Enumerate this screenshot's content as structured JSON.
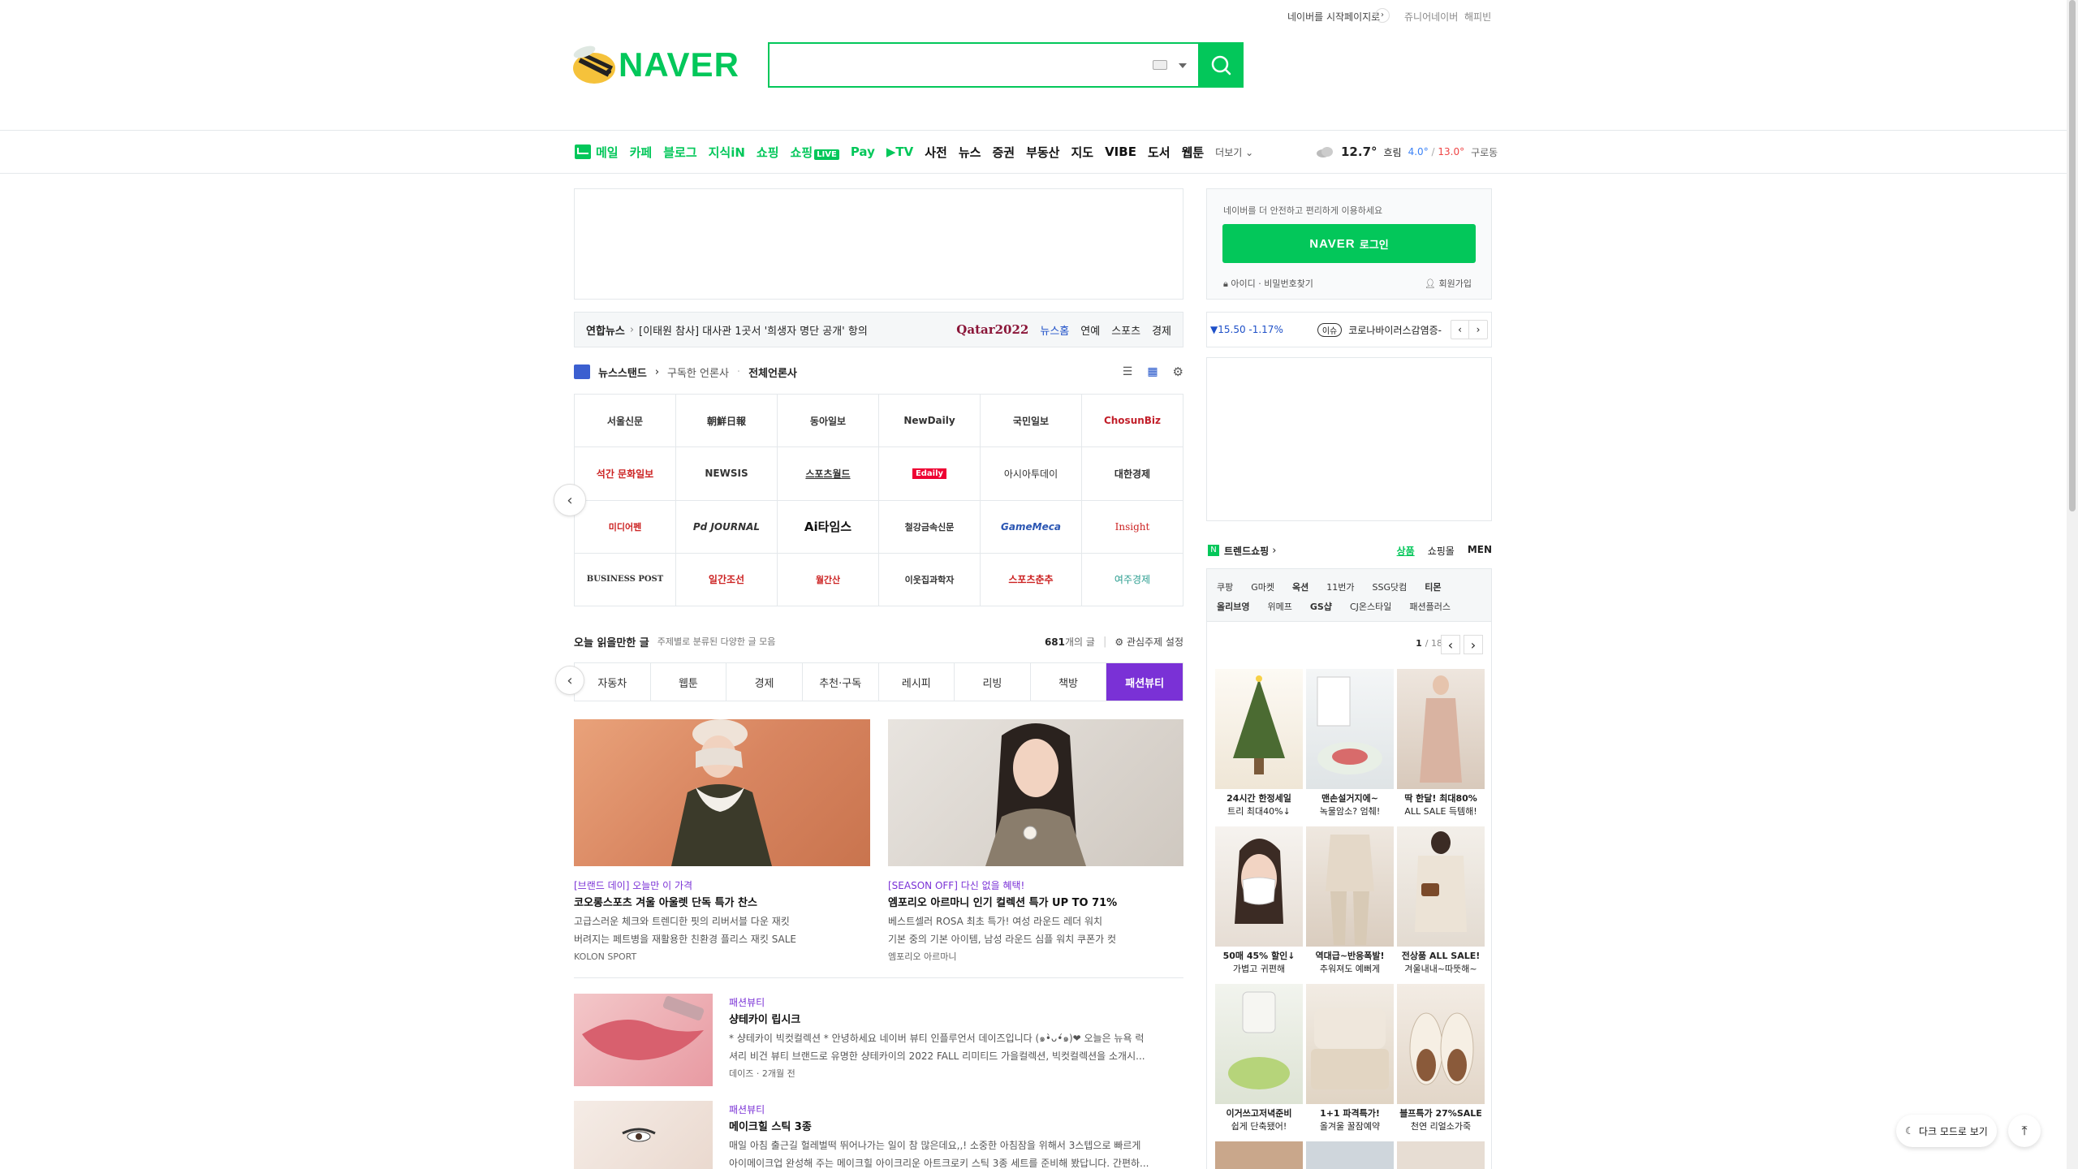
{
  "top_links": {
    "start_page": "네이버를 시작페이지로",
    "junior": "쥬니어네이버",
    "happybean": "해피빈"
  },
  "logo": {
    "text": "NAVER"
  },
  "search": {
    "placeholder": "",
    "keyboard_icon": "keyboard-icon"
  },
  "nav": {
    "items": [
      "메일",
      "카페",
      "블로그",
      "지식iN",
      "쇼핑",
      "쇼핑",
      "Pay",
      "TV",
      "사전",
      "뉴스",
      "증권",
      "부동산",
      "지도",
      "VIBE",
      "도서",
      "웹툰"
    ],
    "live_badge": "LIVE",
    "more": "더보기"
  },
  "weather": {
    "temp": "12.7°",
    "condition": "흐림",
    "low": "4.0°",
    "high": "13.0°",
    "location": "구로동"
  },
  "newsbar": {
    "source": "연합뉴스",
    "headline": "[이태원 참사] 대사관 1곳서 '희생자 명단 공개' 항의",
    "brand": "Qatar2022",
    "links": [
      "뉴스홈",
      "연예",
      "스포츠",
      "경제"
    ]
  },
  "newsstand": {
    "title": "뉴스스탠드",
    "subscribed": "구독한 언론사",
    "all": "전체언론사",
    "papers": [
      "서울신문",
      "朝鮮日報",
      "동아일보",
      "NewDaily",
      "국민일보",
      "ChosunBiz",
      "석간 문화일보",
      "NEWSIS",
      "스포츠월드",
      "Edaily",
      "아시아투데이",
      "대한경제",
      "미디어펜",
      "Pd JOURNAL",
      "Ai타임스",
      "철강금속신문",
      "GameMeca",
      "Insight",
      "BUSINESS POST",
      "일간조선",
      "월간산",
      "이웃집과학자",
      "스포츠춘추",
      "여주경제"
    ]
  },
  "reading": {
    "title": "오늘 읽을만한 글",
    "subtitle": "주제별로 분류된 다양한 글 모음",
    "count": "681",
    "count_suffix": "개의 글",
    "settings": "관심주제 설정",
    "tabs": [
      "자동차",
      "웹툰",
      "경제",
      "추천·구독",
      "레시피",
      "리빙",
      "책방",
      "패션뷰티"
    ],
    "cards": [
      {
        "kicker": "[브랜드 데이] 오늘만 이 가격",
        "title": "코오롱스포츠 겨울 아울렛 단독 특가 찬스",
        "desc1": "고급스러운 체크와 트렌디한 핏의 리버서블 다운 재킷",
        "desc2": "버려지는 페트병을 재활용한 친환경 플리스 재킷 SALE",
        "source": "KOLON SPORT"
      },
      {
        "kicker": "[SEASON OFF] 다신 없을 혜택!",
        "title": "엠포리오 아르마니 인기 컬렉션 특가 UP TO 71%",
        "desc1": "베스트셀러 ROSA 최초 특가! 여성 라운드 레더 워치",
        "desc2": "기본 중의 기본 아이템, 남성 라운드 심플 워치 쿠폰가 컷",
        "source": "엠포리오 아르마니"
      }
    ],
    "list": [
      {
        "kicker": "패션뷰티",
        "title": "샹테카이 립시크",
        "desc1": "* 샹테카이 빅컷컬렉션 * 안녕하세요 네이버 뷰티 인플루언서 데이즈입니다 (๑•̀ᴗ•́๑)❤ 오늘은 뉴욕 럭",
        "desc2": "셔리 비건 뷰티 브랜드로 유명한 샹테카이의 2022 FALL 리미티드 가을컬렉션, 빅컷컬렉션을 소개시...",
        "source": "데이즈 · 2개월 전"
      },
      {
        "kicker": "패션뷰티",
        "title": "메이크힐 스틱 3종",
        "desc1": "매일 아침 출근길 헐레벌떡 뛰어나가는 일이 참 많은데요,,! 소중한 아침잠을 위해서 3스텝으로 빠르게",
        "desc2": "아이메이크업 완성해 주는 메이크힐 아이크리운 아트크로키 스틱 3종 세트를 준비해 봤답니다. 간편하...",
        "source": ""
      }
    ]
  },
  "login": {
    "notice": "네이버를 더 안전하고 편리하게 이용하세요",
    "button_brand": "NAVER",
    "button_label": "로그인",
    "find": "아이디 · 비밀번호찾기",
    "signup": "회원가입"
  },
  "stock": {
    "value": "▼15.50 -1.17%",
    "issue_badge": "이슈",
    "issue_text": "코로나바이러스감염증-"
  },
  "trend": {
    "title": "트렌드쇼핑",
    "tabs": [
      "상품",
      "쇼핑몰",
      "MEN"
    ],
    "shops_row1": [
      "쿠팡",
      "G마켓",
      "옥션",
      "11번가",
      "SSG닷컴",
      "티몬"
    ],
    "shops_row2": [
      "올리브영",
      "위메프",
      "GS샵",
      "CJ온스타일",
      "패션플러스"
    ],
    "page": "1",
    "page_total": "/ 18",
    "products": [
      {
        "line1": "24시간 한정세일",
        "line2": "트리 최대40%↓"
      },
      {
        "line1": "맨손설거지에~",
        "line2": "녹물암소? 엄췌!"
      },
      {
        "line1": "딱 한달! 최대80%",
        "line2": "ALL SALE 득템해!"
      },
      {
        "line1": "50매 45% 할인↓",
        "line2": "가볍고 귀편해"
      },
      {
        "line1": "역대급~반응폭발!",
        "line2": "추워져도 예뻐게"
      },
      {
        "line1": "전상품 ALL SALE!",
        "line2": "겨울내내~따뜻해~"
      },
      {
        "line1": "이거쓰고저녁준비",
        "line2": "쉽게 단축됐어!"
      },
      {
        "line1": "1+1 파격특가!",
        "line2": "올겨울 꿀잠예약"
      },
      {
        "line1": "블프특가 27%SALE",
        "line2": "천연 리얼소가죽"
      }
    ]
  },
  "floating": {
    "darkmode": "다크 모드로 보기"
  },
  "colors": {
    "brand_green": "#03c75a",
    "accent_purple": "#7a31d6",
    "border": "#e4e8eb"
  }
}
